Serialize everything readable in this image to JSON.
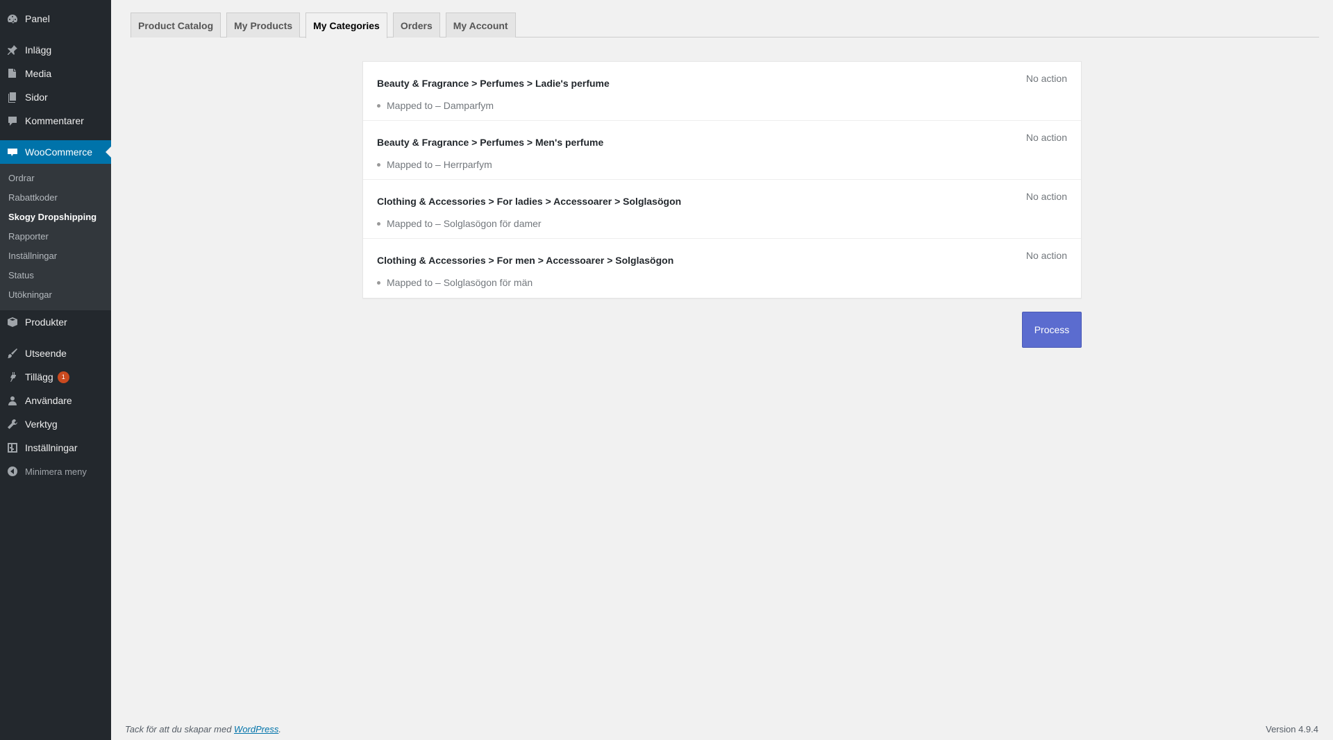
{
  "sidebar": {
    "items_top": [
      {
        "label": "Panel",
        "icon": "dashboard-icon"
      },
      {
        "label": "Inlägg",
        "icon": "pin-icon"
      },
      {
        "label": "Media",
        "icon": "media-icon"
      },
      {
        "label": "Sidor",
        "icon": "pages-icon"
      },
      {
        "label": "Kommentarer",
        "icon": "comment-icon"
      }
    ],
    "woocommerce": {
      "label": "WooCommerce",
      "icon": "woo-icon"
    },
    "submenu": [
      "Ordrar",
      "Rabattkoder",
      "Skogy Dropshipping",
      "Rapporter",
      "Inställningar",
      "Status",
      "Utökningar"
    ],
    "items_bottom": [
      {
        "label": "Produkter",
        "icon": "products-icon"
      },
      {
        "label": "Utseende",
        "icon": "brush-icon"
      },
      {
        "label": "Tillägg",
        "icon": "plugin-icon",
        "badge": "1"
      },
      {
        "label": "Användare",
        "icon": "user-icon"
      },
      {
        "label": "Verktyg",
        "icon": "wrench-icon"
      },
      {
        "label": "Inställningar",
        "icon": "settings-icon"
      }
    ],
    "collapse_label": "Minimera meny"
  },
  "tabs": [
    "Product Catalog",
    "My Products",
    "My Categories",
    "Orders",
    "My Account"
  ],
  "active_tab": "My Categories",
  "mappings": [
    {
      "path": "Beauty & Fragrance > Perfumes > Ladie's perfume",
      "target": "Mapped to – Damparfym",
      "action": "No action"
    },
    {
      "path": "Beauty & Fragrance > Perfumes > Men's perfume",
      "target": "Mapped to – Herrparfym",
      "action": "No action"
    },
    {
      "path": "Clothing & Accessories > For ladies > Accessoarer > Solglasögon",
      "target": "Mapped to – Solglasögon för damer",
      "action": "No action"
    },
    {
      "path": "Clothing & Accessories > For men > Accessoarer > Solglasögon",
      "target": "Mapped to – Solglasögon för män",
      "action": "No action"
    }
  ],
  "process_label": "Process",
  "footer": {
    "thanks_prefix": "Tack för att du skapar med ",
    "link_text": "WordPress",
    "thanks_suffix": ".",
    "version": "Version 4.9.4"
  },
  "colors": {
    "accent": "#0073aa",
    "process_button": "#5b6ccf",
    "badge": "#ca4a1f"
  }
}
